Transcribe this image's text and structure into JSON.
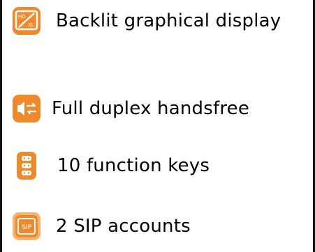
{
  "colors": {
    "accent": "#ef8a2c",
    "accent_light": "#f7b46a",
    "text": "#000000",
    "border": "#111111"
  },
  "features": [
    {
      "icon": "backlit-display-icon",
      "label": "Backlit graphical display",
      "icon_text": [
        "HD",
        "XL"
      ]
    },
    {
      "icon": "full-duplex-handsfree-icon",
      "label": "Full duplex handsfree"
    },
    {
      "icon": "function-keys-icon",
      "label": "10 function keys"
    },
    {
      "icon": "sip-accounts-icon",
      "label": "2 SIP accounts",
      "icon_text": "SIP"
    }
  ]
}
